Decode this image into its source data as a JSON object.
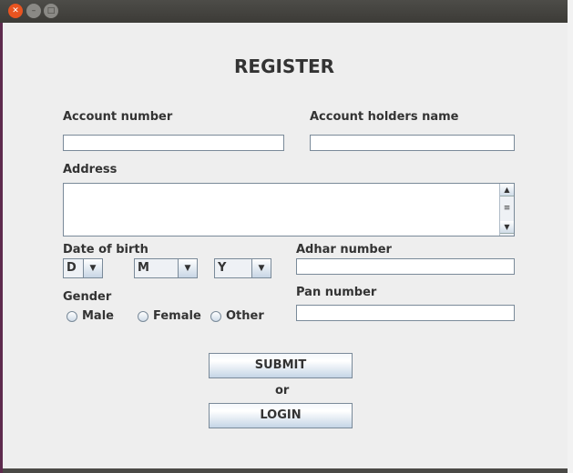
{
  "window": {
    "controls": [
      "close",
      "minimize",
      "maximize"
    ]
  },
  "title": "REGISTER",
  "labels": {
    "account_number": "Account number",
    "holder_name": "Account holders name",
    "address": "Address",
    "dob": "Date of birth",
    "adhar": "Adhar number",
    "gender": "Gender",
    "pan": "Pan number",
    "or": "or"
  },
  "fields": {
    "account_number": "",
    "holder_name": "",
    "address": "",
    "adhar": "",
    "pan": ""
  },
  "dob": {
    "day": "D",
    "month": "M",
    "year": "Y"
  },
  "gender_options": [
    "Male",
    "Female",
    "Other"
  ],
  "buttons": {
    "submit": "SUBMIT",
    "login": "LOGIN"
  }
}
